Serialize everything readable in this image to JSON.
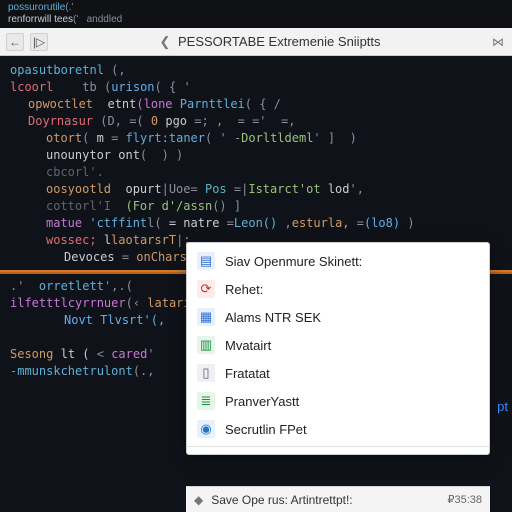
{
  "top_strip": {
    "line1_a": "possurorutile",
    "line1_b": "(.'",
    "line2_a": "renforrwill tees",
    "line2_b": "('   anddled"
  },
  "title_bar": {
    "back_glyph": "←",
    "fwd_glyph": "|▷",
    "chevron_glyph": "❮",
    "title": "PESSORTABE Extremenie Sniiptts",
    "right_glyph": "⋈"
  },
  "code": {
    "l01_a": "opasutboretnl",
    "l01_b": "(,",
    "l02_a": "lcoorl",
    "l02_b": "tb",
    "l02_c": "(",
    "l02_d": "urison",
    "l02_e": "( { '",
    "l03_a": "opwoctlet",
    "l03_b": "etnt",
    "l03_c": "(lone",
    "l03_d": "Parnttlei",
    "l03_e": "( { /",
    "l04_a": "Doyrnasur",
    "l04_b": "(D,",
    "l04_c": "=(",
    "l04_d": "0",
    "l04_e": "pgo",
    "l04_f": "=; ,",
    "l04_g": "= ='",
    "l04_h": "=,",
    "l05_a": "otort",
    "l05_b": "(",
    "l05_c": "m",
    "l05_d": "=",
    "l05_e": "flyrt:taner",
    "l05_f": "( '",
    "l05_g": "-",
    "l05_h": "Dorltldeml",
    "l05_i": "'",
    "l05_j": "]  )",
    "l06_a": "unounytor ont",
    "l06_b": "(  ) )",
    "l07_a": "cbcorl'.",
    "l08_a": "oosyootld",
    "l08_b": "opurt",
    "l08_c": "|Uoe=",
    "l08_d": "Pos",
    "l08_e": "=|",
    "l08_f": "Istarct'ot",
    "l08_g": "lod",
    "l08_h": "',",
    "l09_a": "cottorl'I",
    "l09_b": "(For d'/assn",
    "l09_c": "() ]",
    "l10_a": "matue",
    "l10_b": "'ctffint",
    "l10_c": "l(",
    "l10_d": "= natre",
    "l10_e": "=",
    "l10_f": "Leon()",
    "l10_g": ",",
    "l10_h": "esturla,",
    "l10_i": "=",
    "l10_j": "(lo8)",
    "l10_k": ")",
    "l11_a": "wossec;",
    "l11_b": "l",
    "l11_c": "laotarsrT",
    "l11_d": "|;",
    "l12_a": "Devoces",
    "l12_b": "=",
    "l12_c": "onCharseor()",
    "l13_a": ".'",
    "l13_b": "orretlett",
    "l13_c": "',.(",
    "l14_a": "ilfetttlcyrrnuer",
    "l14_b": "(‹",
    "l14_c": "lataril",
    "l14_d": ",  ,",
    "l15_a": "Novt",
    "l15_b": "Tlvsrt'(,",
    "l16_a": "Sesong",
    "l16_b": "lt (",
    "l16_c": "<",
    "l16_d": "cared",
    "l16_e": "'",
    "l17_a": "-",
    "l17_b": "mmunskchetrulont",
    "l17_c": "(.,"
  },
  "side_hint": "pt",
  "context_menu": {
    "items": [
      {
        "label": "Siav Openmure Skinett:",
        "icon_name": "document-lines-icon",
        "icon_bg": "#e8f0fb",
        "icon_fg": "#2f6fd0"
      },
      {
        "label": "Rehet:",
        "icon_name": "refresh-page-icon",
        "icon_bg": "#fdeaea",
        "icon_fg": "#c0392b"
      },
      {
        "label": "Alams NTR SEK",
        "icon_name": "grid-icon",
        "icon_bg": "#e8f0fb",
        "icon_fg": "#2f6fd0"
      },
      {
        "label": "Mvatairt",
        "icon_name": "sheet-green-icon",
        "icon_bg": "#e6f5ea",
        "icon_fg": "#1e8e3e"
      },
      {
        "label": "Fratatat",
        "icon_name": "page-icon",
        "icon_bg": "#eef0f3",
        "icon_fg": "#5a6270"
      },
      {
        "label": "PranverYastt",
        "icon_name": "layers-icon",
        "icon_bg": "#e6f5ea",
        "icon_fg": "#1e8e3e"
      },
      {
        "label": "Secrutlin FPet",
        "icon_name": "shield-icon",
        "icon_bg": "#e6f1fb",
        "icon_fg": "#2176c7"
      }
    ]
  },
  "footer": {
    "icon_glyph": "◆",
    "label": "Save Ope rus: Artintrettpt!:",
    "meta": "₽35:38"
  },
  "icons": {
    "doc_lines": "▤",
    "refresh": "⟳",
    "grid": "▦",
    "sheet": "▥",
    "page": "▯",
    "layers": "≣",
    "shield": "◉"
  }
}
